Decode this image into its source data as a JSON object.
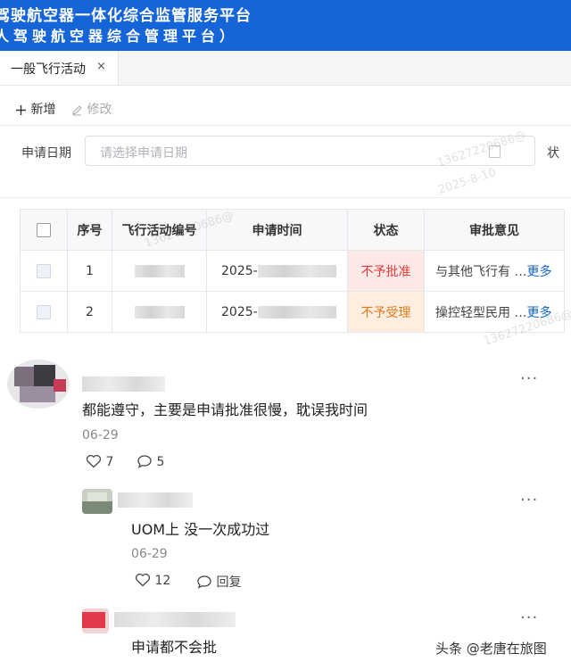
{
  "banner": {
    "line1": "驾驶航空器一体化综合监管服务平台",
    "line2": "人驾驶航空器综合管理平台）"
  },
  "tabs": [
    {
      "label": "一般飞行活动",
      "close": "×"
    }
  ],
  "toolbar": {
    "add_label": "新增",
    "edit_label": "修改",
    "add_icon": "plus-icon",
    "edit_icon": "pencil-icon"
  },
  "filter": {
    "label": "申请日期",
    "placeholder": "请选择申请日期",
    "status_label": "状"
  },
  "table": {
    "headers": [
      "序号",
      "飞行活动编号",
      "申请时间",
      "状态",
      "审批意见"
    ],
    "rows": [
      {
        "index": "1",
        "time": "2025-",
        "status": "不予批准",
        "opinion": "与其他飞行有 …",
        "more": "更多",
        "status_color": "#e53935"
      },
      {
        "index": "2",
        "time": "2025-",
        "status": "不予受理",
        "opinion": "操控轻型民用 …",
        "more": "更多",
        "status_color": "#e07b20"
      }
    ]
  },
  "watermark": {
    "phone": "13627220686@",
    "date": "2025-8-10"
  },
  "comments": [
    {
      "text": "都能遵守，主要是申请批准很慢，耽误我时间",
      "date": "06-29",
      "likes": "7",
      "replies": "5",
      "more": "···"
    },
    {
      "text": "UOM上 没一次成功过",
      "date": "06-29",
      "likes": "12",
      "reply_label": "回复",
      "more": "···"
    },
    {
      "text": "申请都不会批",
      "more": "···"
    }
  ],
  "footer": {
    "credit": "头条 @老唐在旅图"
  }
}
